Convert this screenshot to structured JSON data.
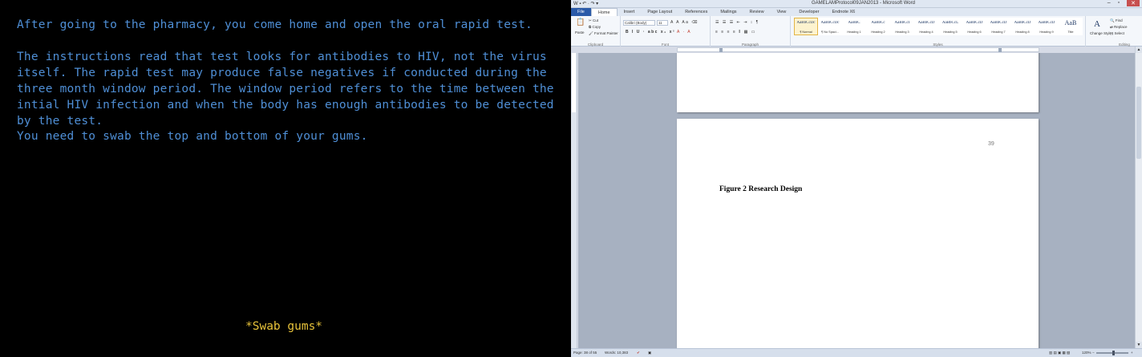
{
  "game": {
    "paragraph1": "After going to the pharmacy, you come home and open the oral rapid test.",
    "paragraph2": "The instructions read that test looks for antibodies to HIV, not the virus itself. The rapid test may produce false negatives if conducted during the three month window period. The window period refers to the time between the intial HIV infection and when the body has enough antibodies to be detected by the test.",
    "paragraph3": "You need to swab the top and bottom of your gums.",
    "link": "*Swab gums*",
    "colors": {
      "text": "#4f8fd6",
      "link": "#e7c23a",
      "background": "#000000"
    }
  },
  "word": {
    "title": "GAMELAMProtocol09JAN2013 - Microsoft Word",
    "tabs": [
      "File",
      "Home",
      "Insert",
      "Page Layout",
      "References",
      "Mailings",
      "Review",
      "View",
      "Developer",
      "Endnote X6"
    ],
    "clipboard": {
      "paste": "Paste",
      "cut": "Cut",
      "copy": "Copy",
      "format_painter": "Format Painter",
      "label": "Clipboard"
    },
    "font": {
      "family": "Calibri (Body)",
      "size": "11",
      "label": "Font"
    },
    "paragraph_label": "Paragraph",
    "styles": [
      {
        "sample": "AaBbCcDc",
        "name": "¶ Normal"
      },
      {
        "sample": "AaBbCcDc",
        "name": "¶ No Spaci..."
      },
      {
        "sample": "AaBbC",
        "name": "Heading 1"
      },
      {
        "sample": "AaBbCc",
        "name": "Heading 2"
      },
      {
        "sample": "AaBbCcI",
        "name": "Heading 3"
      },
      {
        "sample": "AaBbCcD",
        "name": "Heading 4"
      },
      {
        "sample": "AaBbCcL",
        "name": "Heading 5"
      },
      {
        "sample": "AaBbCcD",
        "name": "Heading 6"
      },
      {
        "sample": "AaBbCcD",
        "name": "Heading 7"
      },
      {
        "sample": "AaBbCcD",
        "name": "Heading 8"
      },
      {
        "sample": "AaBbCcD",
        "name": "Heading 9"
      },
      {
        "sample": "AaB",
        "name": "Title"
      }
    ],
    "styles_label": "Styles",
    "change_styles": "Change Styles",
    "editing": {
      "find": "Find",
      "replace": "Replace",
      "select": "Select",
      "label": "Editing"
    },
    "document": {
      "page_number": "39",
      "figure_caption": "Figure 2 Research Design"
    },
    "status": {
      "page": "Page: 38 of 55",
      "words": "Words: 10,383",
      "zoom": "120%",
      "zoom_fraction": 0.55
    },
    "colors": {
      "file_tab": "#2a5aa8",
      "workspace": "#a7b1c1",
      "selected_style": "#e3b545"
    }
  }
}
